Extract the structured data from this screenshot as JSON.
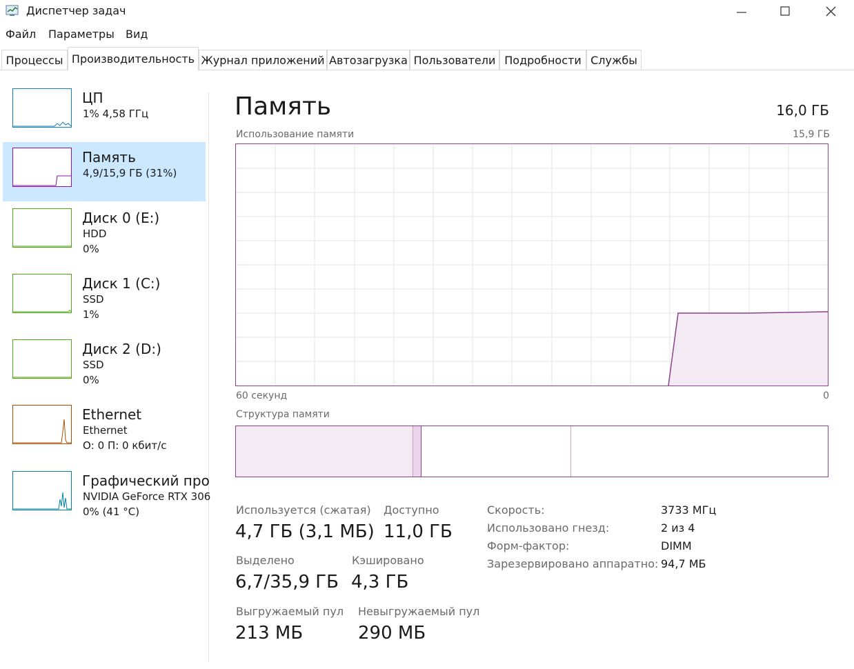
{
  "window": {
    "title": "Диспетчер задач",
    "accent_color": "#8b418b",
    "selection_color": "#cce8ff"
  },
  "menu": [
    "Файл",
    "Параметры",
    "Вид"
  ],
  "tabs": [
    "Процессы",
    "Производительность",
    "Журнал приложений",
    "Автозагрузка",
    "Пользователи",
    "Подробности",
    "Службы"
  ],
  "active_tab": "Производительность",
  "sidebar": [
    {
      "title": "ЦП",
      "line1": "1% 4,58 ГГц",
      "line2": "",
      "color": "#117dbb",
      "selected": false
    },
    {
      "title": "Память",
      "line1": "4,9/15,9 ГБ (31%)",
      "line2": "",
      "color": "#8b12ae",
      "selected": true
    },
    {
      "title": "Диск 0 (E:)",
      "line1": "HDD",
      "line2": "0%",
      "color": "#4da60c",
      "selected": false
    },
    {
      "title": "Диск 1 (C:)",
      "line1": "SSD",
      "line2": "1%",
      "color": "#4da60c",
      "selected": false
    },
    {
      "title": "Диск 2 (D:)",
      "line1": "SSD",
      "line2": "0%",
      "color": "#4da60c",
      "selected": false
    },
    {
      "title": "Ethernet",
      "line1": "Ethernet",
      "line2": "О: 0 П: 0 кбит/с",
      "color": "#a74f01",
      "selected": false
    },
    {
      "title": "Графический про",
      "line1": "NVIDIA GeForce RTX 306",
      "line2": "0% (41 °C)",
      "color": "#008299",
      "selected": false
    }
  ],
  "main": {
    "title": "Память",
    "total": "16,0 ГБ",
    "usage_caption": "Использование памяти",
    "usage_max": "15,9 ГБ",
    "time_left": "60 секунд",
    "time_right": "0",
    "structure_caption": "Структура памяти",
    "stats": {
      "in_use_label": "Используется (сжатая)",
      "in_use_value": "4,7 ГБ (3,1 МБ)",
      "available_label": "Доступно",
      "available_value": "11,0 ГБ",
      "committed_label": "Выделено",
      "committed_value": "6,7/35,9 ГБ",
      "cached_label": "Кэшировано",
      "cached_value": "4,3 ГБ",
      "paged_label": "Выгружаемый пул",
      "paged_value": "213 МБ",
      "nonpaged_label": "Невыгружаемый пул",
      "nonpaged_value": "290 МБ"
    },
    "specs": [
      {
        "label": "Скорость:",
        "value": "3733 МГц"
      },
      {
        "label": "Использовано гнезд:",
        "value": "2 из 4"
      },
      {
        "label": "Форм-фактор:",
        "value": "DIMM"
      },
      {
        "label": "Зарезервировано аппаратно:",
        "value": "94,7 МБ"
      }
    ]
  }
}
